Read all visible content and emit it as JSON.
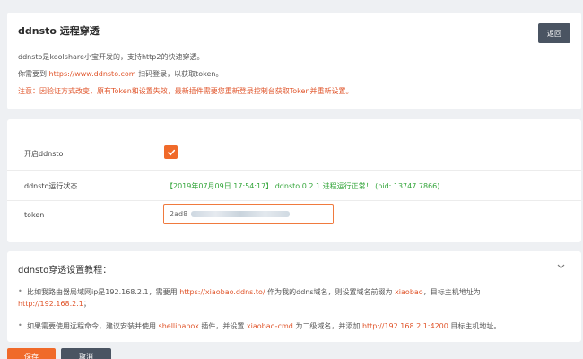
{
  "intro": {
    "title": "ddnsto 远程穿透",
    "back_label": "返回",
    "line1": "ddnsto是koolshare小宝开发的，支持http2的快速穿透。",
    "line2_prefix": "你需要到 ",
    "line2_link": "https://www.ddnsto.com",
    "line2_suffix": " 扫码登录，以获取token。",
    "warning_label": "注意：",
    "warning_text": "因验证方式改变，原有Token和设置失效，最新插件需要您重新登录控制台获取Token并重新设置。"
  },
  "settings": {
    "enable_label": "开启ddnsto",
    "enabled": true,
    "status_label": "ddnsto运行状态",
    "status_text": "【2019年07月09日 17:54:17】 ddnsto 0.2.1 进程运行正常！ (pid: 13747 7866)",
    "token_label": "token",
    "token_value": "2ad8"
  },
  "guide": {
    "title": "ddnsto穿透设置教程：",
    "item1_a": "比如我路由器局域网ip是192.168.2.1，需要用 ",
    "item1_link": "https://xiaobao.ddns.to/",
    "item1_b": " 作为我的ddns域名，则设置域名前缀为 ",
    "item1_prefix": "xiaobao",
    "item1_c": "，目标主机地址为",
    "item1_target": "http://192.168.2.1",
    "item1_end": "；",
    "item2_a": "如果需要使用远程命令，建议安装并使用 ",
    "item2_plugin": "shellinabox",
    "item2_b": " 插件，并设置 ",
    "item2_domain": "xiaobao-cmd",
    "item2_c": " 为二级域名，并添加 ",
    "item2_url": "http://192.168.2.1:4200",
    "item2_d": " 目标主机地址。"
  },
  "actions": {
    "save_label": "保存",
    "cancel_label": "取消"
  },
  "colors": {
    "accent": "#f06a2a",
    "status_green": "#33a53a",
    "dark_button": "#4a5462"
  }
}
